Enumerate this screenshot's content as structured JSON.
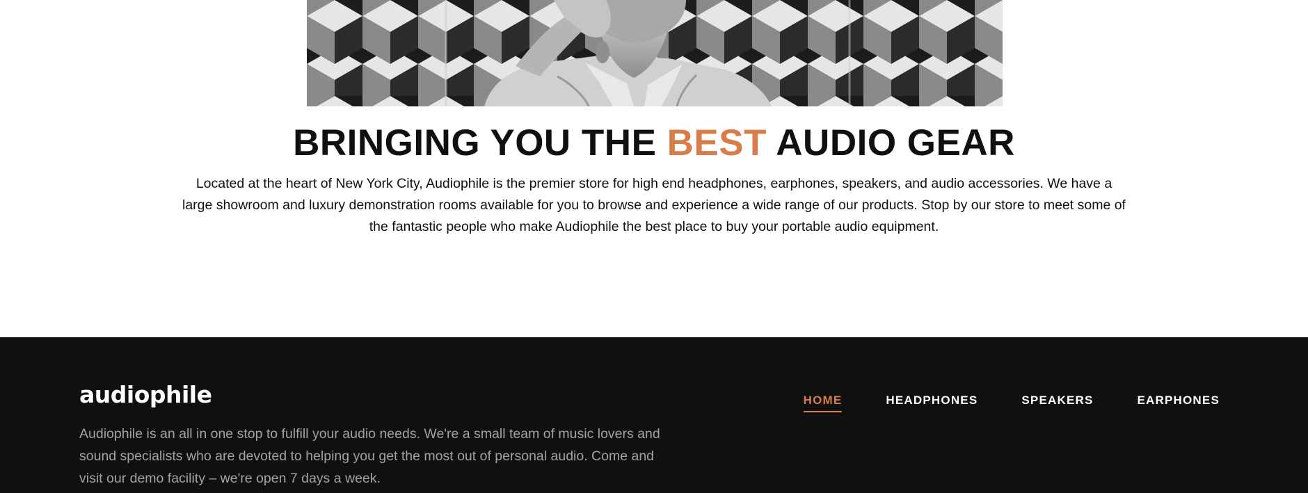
{
  "about": {
    "title_before": "BRINGING YOU THE ",
    "title_accent": "BEST",
    "title_after": " AUDIO GEAR",
    "description": "Located at the heart of New York City, Audiophile is the premier store for high end headphones, earphones, speakers, and audio accessories. We have a large showroom and luxury demonstration rooms available for you to browse and experience a wide range of our products. Stop by our store to meet some of the fantastic people who make Audiophile the best place to buy your portable audio equipment."
  },
  "footer": {
    "logo": "audiophile",
    "description": "Audiophile is an all in one stop to fulfill your audio needs. We're a small team of music lovers and sound specialists who are devoted to helping you get the most out of personal audio. Come and visit our demo facility – we're open 7 days a week.",
    "nav": [
      {
        "label": "HOME",
        "active": true
      },
      {
        "label": "HEADPHONES",
        "active": false
      },
      {
        "label": "SPEAKERS",
        "active": false
      },
      {
        "label": "EARPHONES",
        "active": false
      }
    ]
  },
  "colors": {
    "accent": "#d87d4a",
    "footer_bg": "#101010",
    "text_dark": "#101010",
    "text_muted": "#a3a3a3"
  }
}
